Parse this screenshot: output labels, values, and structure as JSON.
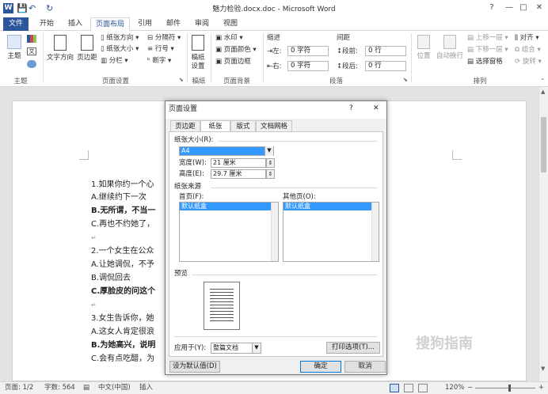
{
  "window": {
    "title": "魅力检验.docx.doc - Microsoft Word",
    "help": "?",
    "minimize": "—",
    "restore": "□",
    "close": "✕"
  },
  "quick_access": {
    "save": "💾",
    "undo": "↶",
    "redo": "↻"
  },
  "tabs": [
    "文件",
    "开始",
    "插入",
    "页面布局",
    "引用",
    "邮件",
    "审阅",
    "视图"
  ],
  "ribbon": {
    "theme_group": {
      "theme_label": "主题",
      "group_label": "主题"
    },
    "page_setup": {
      "text_dir": "文字方向",
      "margins": "页边距",
      "orientation": "纸张方向 ▾",
      "size": "纸张大小 ▾",
      "columns": "分栏 ▾",
      "breaks": "分隔符 ▾",
      "line_numbers": "行号 ▾",
      "hyphenation": "断字 ▾",
      "group_label": "页面设置"
    },
    "draft": {
      "label": "稿纸设置",
      "group_label": "稿纸"
    },
    "bg": {
      "watermark": "水印 ▾",
      "page_color": "页面颜色 ▾",
      "page_border": "页面边框",
      "group_label": "页面背景"
    },
    "para": {
      "indent": "缩进",
      "spacing": "间距",
      "left_label": "左:",
      "left_value": "0 字符",
      "right_label": "右:",
      "right_value": "0 字符",
      "before_label": "段前:",
      "before_value": "0 行",
      "after_label": "段后:",
      "after_value": "0 行",
      "group_label": "段落"
    },
    "arrange": {
      "position": "位置",
      "wrap": "自动换行",
      "forward": "上移一层 ▾",
      "backward": "下移一层 ▾",
      "selection_pane": "选择窗格",
      "align": "对齐 ▾",
      "group": "组合 ▾",
      "rotate": "旋转 ▾",
      "group_label": "排列"
    }
  },
  "document": {
    "lines": [
      {
        "text": "1.如果你约一个心"
      },
      {
        "text": "A.继续约下一次"
      },
      {
        "text": "B.无所谓，不当一",
        "bold": true
      },
      {
        "text": "C.再也不约她了，"
      },
      {
        "text": "↵"
      },
      {
        "text": "2.一个女生在公众"
      },
      {
        "text": "A.让她调侃，不予"
      },
      {
        "text": "B.调侃回去"
      },
      {
        "text": "C.厚脸皮的问这个",
        "bold": true
      },
      {
        "text": "↵"
      },
      {
        "text": "3.女生告诉你，她"
      },
      {
        "text": "A.这女人肯定很浪"
      },
      {
        "text": "B.为她高兴，说明",
        "bold": true
      },
      {
        "text": "C.会有点吃醋，为"
      }
    ]
  },
  "dialog": {
    "title": "页面设置",
    "help": "?",
    "close": "✕",
    "tabs": [
      "页边距",
      "纸张",
      "版式",
      "文档网格"
    ],
    "paper_size_label": "纸张大小(R):",
    "paper_size_value": "A4",
    "width_label": "宽度(W):",
    "width_value": "21 厘米",
    "height_label": "高度(E):",
    "height_value": "29.7 厘米",
    "source_label": "纸张来源",
    "first_page_label": "首页(F):",
    "first_page_value": "默认纸盒",
    "other_pages_label": "其他页(O):",
    "other_pages_value": "默认纸盒",
    "preview_label": "预览",
    "apply_label": "应用于(Y):",
    "apply_value": "整篇文档",
    "print_options": "打印选项(T)...",
    "set_default": "设为默认值(D)",
    "ok": "确定",
    "cancel": "取消"
  },
  "status": {
    "page": "页面: 1/2",
    "words": "字数: 564",
    "lang": "中文(中国)",
    "mode": "插入",
    "zoom": "120%",
    "minus": "−",
    "plus": "+"
  },
  "watermark": "搜狗指南"
}
